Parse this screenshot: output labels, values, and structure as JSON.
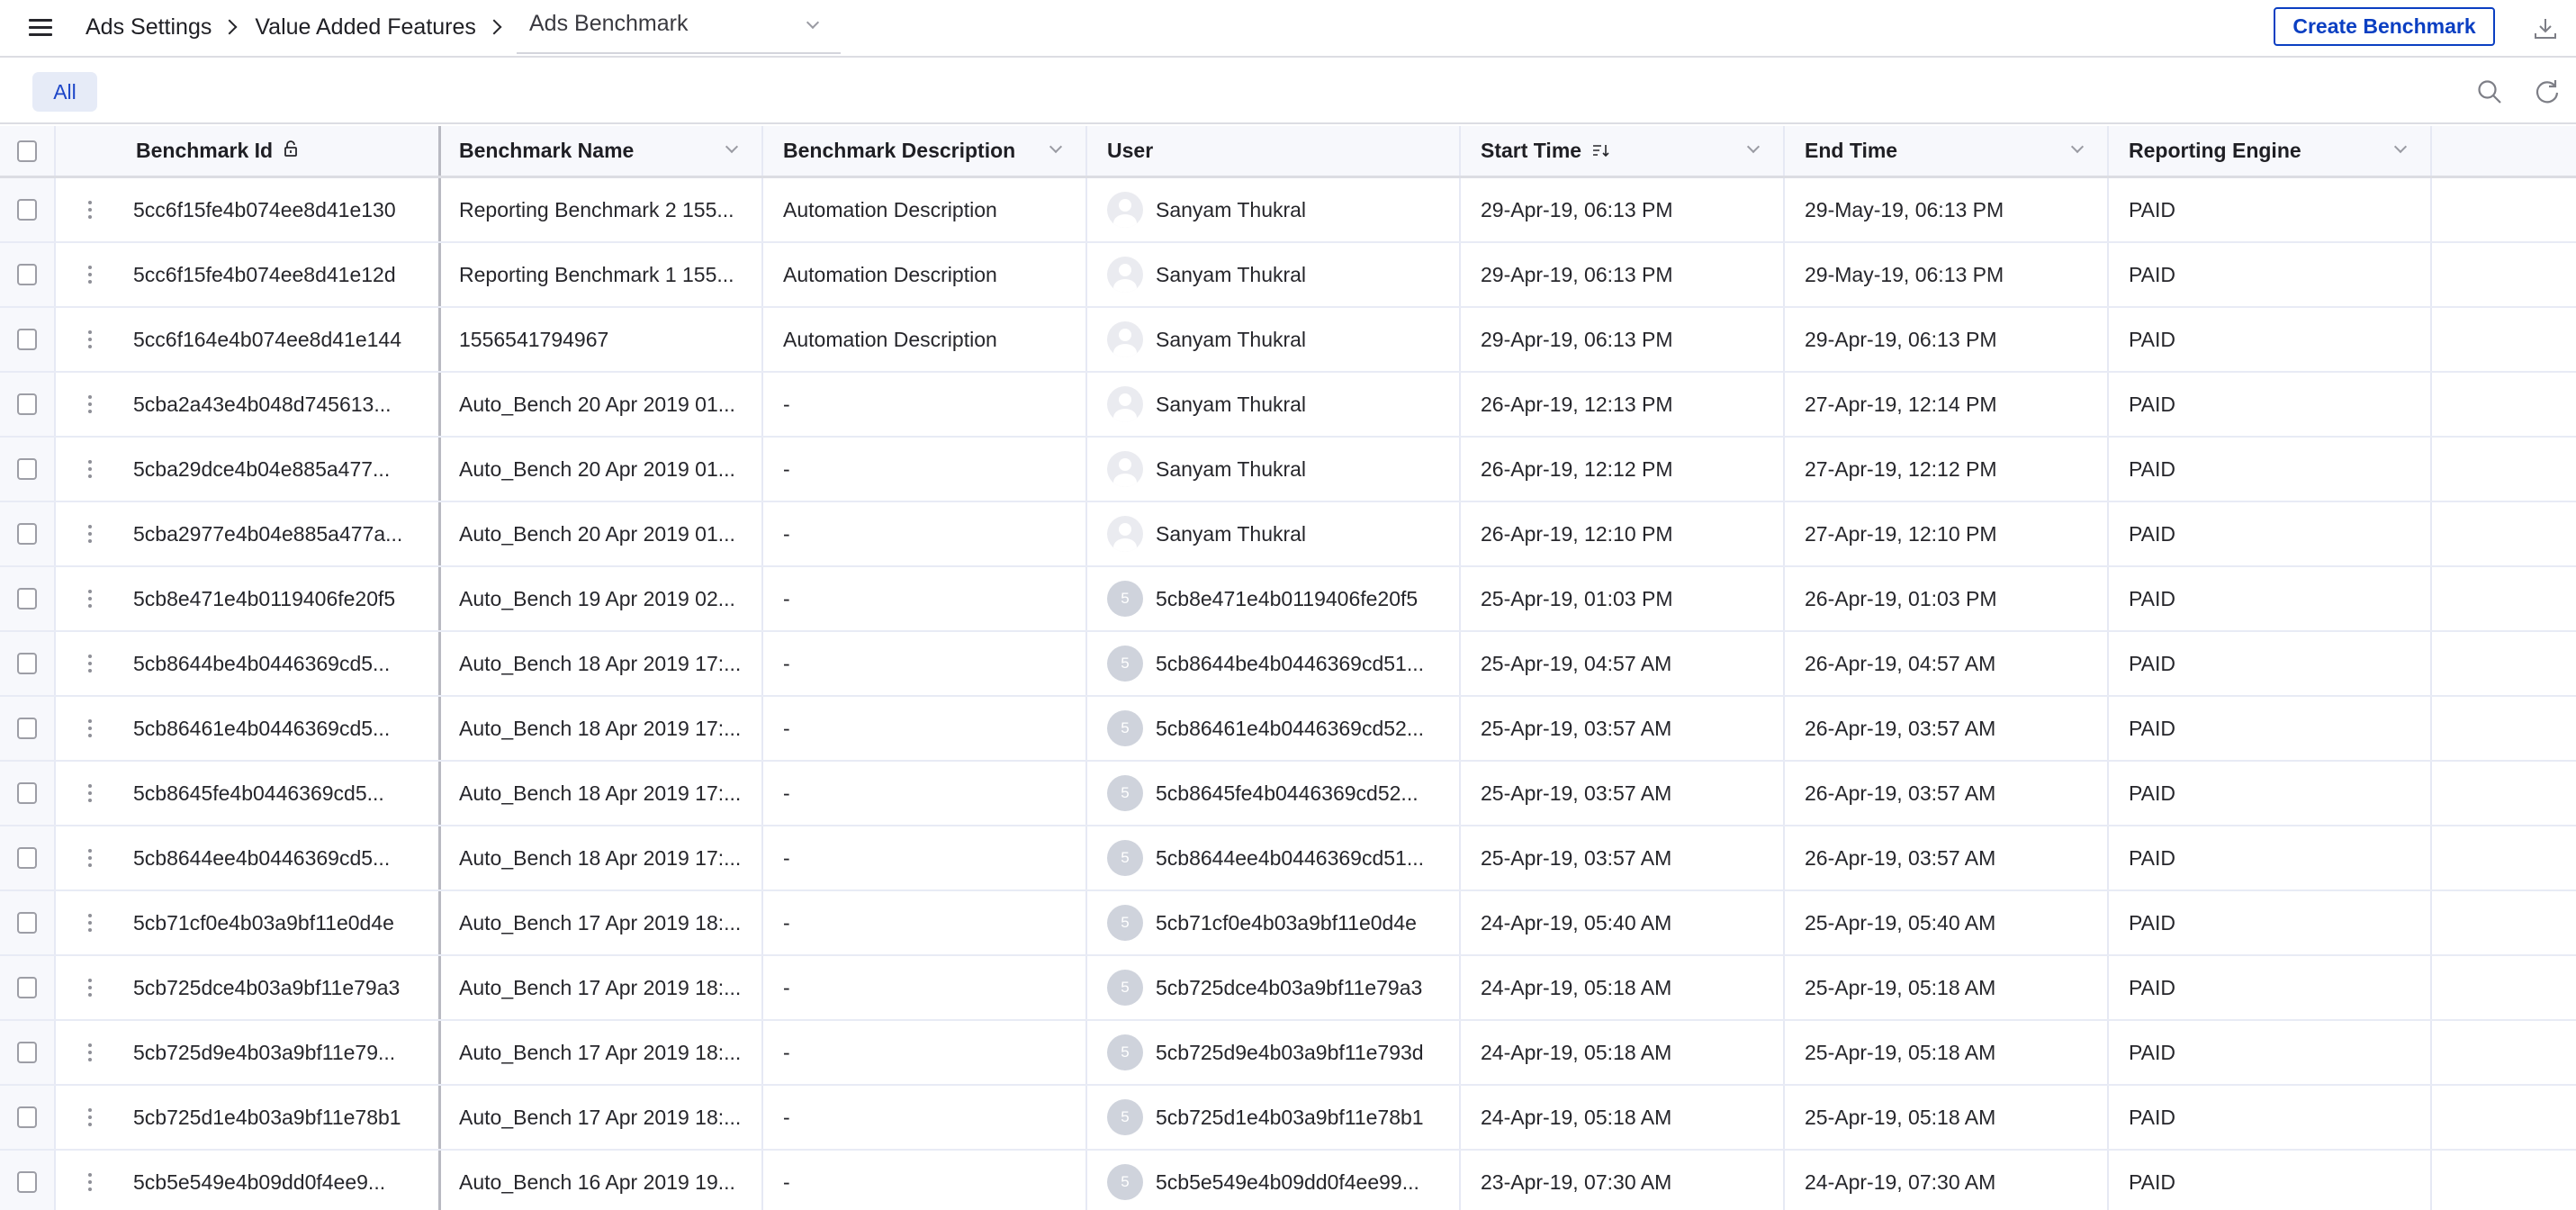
{
  "topbar": {
    "breadcrumb": [
      "Ads Settings",
      "Value Added Features"
    ],
    "page_select": "Ads Benchmark",
    "create_button": "Create Benchmark",
    "icons": {
      "menu": "hamburger-menu-icon",
      "download": "download-icon"
    }
  },
  "toolbar": {
    "filter_chip": "All",
    "icons": {
      "search": "search-icon",
      "refresh": "refresh-icon"
    }
  },
  "colors": {
    "accent": "#0b3fc2",
    "chip_bg": "#e6ebf7",
    "header_bg": "#f7f8fc",
    "avatar_initial_bg": "#cfd3dc"
  },
  "table": {
    "columns": [
      {
        "key": "id",
        "label": "Benchmark Id",
        "icon": "lock-icon"
      },
      {
        "key": "name",
        "label": "Benchmark Name",
        "icon": "chevron-down-icon"
      },
      {
        "key": "description",
        "label": "Benchmark Description",
        "icon": "chevron-down-icon"
      },
      {
        "key": "user",
        "label": "User"
      },
      {
        "key": "start",
        "label": "Start Time",
        "icon": "sort-descending-icon"
      },
      {
        "key": "end",
        "label": "End Time",
        "icon": "chevron-down-icon"
      },
      {
        "key": "engine",
        "label": "Reporting Engine",
        "icon": "chevron-down-icon"
      }
    ],
    "rows": [
      {
        "id": "5cc6f15fe4b074ee8d41e130",
        "name": "Reporting Benchmark 2 155...",
        "description": "Automation Description",
        "user": "Sanyam Thukral",
        "avatar": "placeholder",
        "start": "29-Apr-19, 06:13 PM",
        "end": "29-May-19, 06:13 PM",
        "engine": "PAID"
      },
      {
        "id": "5cc6f15fe4b074ee8d41e12d",
        "name": "Reporting Benchmark 1 155...",
        "description": "Automation Description",
        "user": "Sanyam Thukral",
        "avatar": "placeholder",
        "start": "29-Apr-19, 06:13 PM",
        "end": "29-May-19, 06:13 PM",
        "engine": "PAID"
      },
      {
        "id": "5cc6f164e4b074ee8d41e144",
        "name": "1556541794967",
        "description": "Automation Description",
        "user": "Sanyam Thukral",
        "avatar": "placeholder",
        "start": "29-Apr-19, 06:13 PM",
        "end": "29-Apr-19, 06:13 PM",
        "engine": "PAID"
      },
      {
        "id": "5cba2a43e4b048d745613...",
        "name": "Auto_Bench 20 Apr 2019 01...",
        "description": "-",
        "user": "Sanyam Thukral",
        "avatar": "placeholder",
        "start": "26-Apr-19, 12:13 PM",
        "end": "27-Apr-19, 12:14 PM",
        "engine": "PAID"
      },
      {
        "id": "5cba29dce4b04e885a477...",
        "name": "Auto_Bench 20 Apr 2019 01...",
        "description": "-",
        "user": "Sanyam Thukral",
        "avatar": "placeholder",
        "start": "26-Apr-19, 12:12 PM",
        "end": "27-Apr-19, 12:12 PM",
        "engine": "PAID"
      },
      {
        "id": "5cba2977e4b04e885a477a...",
        "name": "Auto_Bench 20 Apr 2019 01...",
        "description": "-",
        "user": "Sanyam Thukral",
        "avatar": "placeholder",
        "start": "26-Apr-19, 12:10 PM",
        "end": "27-Apr-19, 12:10 PM",
        "engine": "PAID"
      },
      {
        "id": "5cb8e471e4b0119406fe20f5",
        "name": "Auto_Bench 19 Apr 2019 02...",
        "description": "-",
        "user": "5cb8e471e4b0119406fe20f5",
        "avatar": "5",
        "start": "25-Apr-19, 01:03 PM",
        "end": "26-Apr-19, 01:03 PM",
        "engine": "PAID"
      },
      {
        "id": "5cb8644be4b0446369cd5...",
        "name": "Auto_Bench 18 Apr 2019 17:...",
        "description": "-",
        "user": "5cb8644be4b0446369cd51...",
        "avatar": "5",
        "start": "25-Apr-19, 04:57 AM",
        "end": "26-Apr-19, 04:57 AM",
        "engine": "PAID"
      },
      {
        "id": "5cb86461e4b0446369cd5...",
        "name": "Auto_Bench 18 Apr 2019 17:...",
        "description": "-",
        "user": "5cb86461e4b0446369cd52...",
        "avatar": "5",
        "start": "25-Apr-19, 03:57 AM",
        "end": "26-Apr-19, 03:57 AM",
        "engine": "PAID"
      },
      {
        "id": "5cb8645fe4b0446369cd5...",
        "name": "Auto_Bench 18 Apr 2019 17:...",
        "description": "-",
        "user": "5cb8645fe4b0446369cd52...",
        "avatar": "5",
        "start": "25-Apr-19, 03:57 AM",
        "end": "26-Apr-19, 03:57 AM",
        "engine": "PAID"
      },
      {
        "id": "5cb8644ee4b0446369cd5...",
        "name": "Auto_Bench 18 Apr 2019 17:...",
        "description": "-",
        "user": "5cb8644ee4b0446369cd51...",
        "avatar": "5",
        "start": "25-Apr-19, 03:57 AM",
        "end": "26-Apr-19, 03:57 AM",
        "engine": "PAID"
      },
      {
        "id": "5cb71cf0e4b03a9bf11e0d4e",
        "name": "Auto_Bench 17 Apr 2019 18:...",
        "description": "-",
        "user": "5cb71cf0e4b03a9bf11e0d4e",
        "avatar": "5",
        "start": "24-Apr-19, 05:40 AM",
        "end": "25-Apr-19, 05:40 AM",
        "engine": "PAID"
      },
      {
        "id": "5cb725dce4b03a9bf11e79a3",
        "name": "Auto_Bench 17 Apr 2019 18:...",
        "description": "-",
        "user": "5cb725dce4b03a9bf11e79a3",
        "avatar": "5",
        "start": "24-Apr-19, 05:18 AM",
        "end": "25-Apr-19, 05:18 AM",
        "engine": "PAID"
      },
      {
        "id": "5cb725d9e4b03a9bf11e79...",
        "name": "Auto_Bench 17 Apr 2019 18:...",
        "description": "-",
        "user": "5cb725d9e4b03a9bf11e793d",
        "avatar": "5",
        "start": "24-Apr-19, 05:18 AM",
        "end": "25-Apr-19, 05:18 AM",
        "engine": "PAID"
      },
      {
        "id": "5cb725d1e4b03a9bf11e78b1",
        "name": "Auto_Bench 17 Apr 2019 18:...",
        "description": "-",
        "user": "5cb725d1e4b03a9bf11e78b1",
        "avatar": "5",
        "start": "24-Apr-19, 05:18 AM",
        "end": "25-Apr-19, 05:18 AM",
        "engine": "PAID"
      },
      {
        "id": "5cb5e549e4b09dd0f4ee9...",
        "name": "Auto_Bench 16 Apr 2019 19...",
        "description": "-",
        "user": "5cb5e549e4b09dd0f4ee99...",
        "avatar": "5",
        "start": "23-Apr-19, 07:30 AM",
        "end": "24-Apr-19, 07:30 AM",
        "engine": "PAID"
      }
    ]
  }
}
